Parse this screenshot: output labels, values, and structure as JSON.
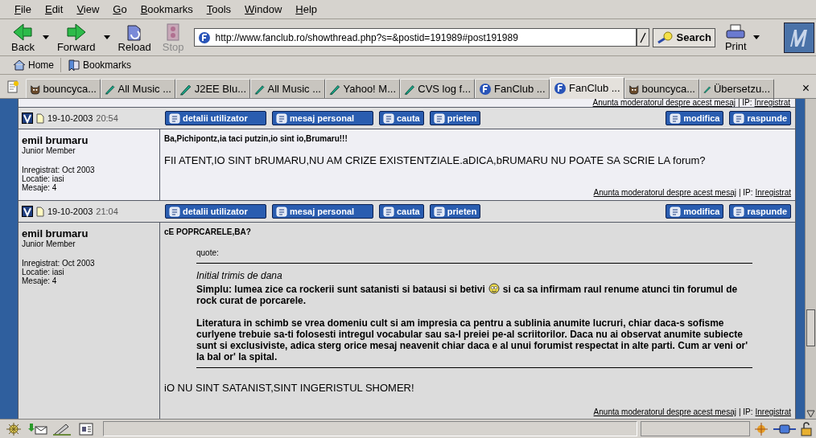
{
  "menu": [
    {
      "label": "File"
    },
    {
      "label": "Edit"
    },
    {
      "label": "View"
    },
    {
      "label": "Go"
    },
    {
      "label": "Bookmarks"
    },
    {
      "label": "Tools"
    },
    {
      "label": "Window"
    },
    {
      "label": "Help"
    }
  ],
  "toolbar": {
    "nav": [
      {
        "kind": "back",
        "label": "Back",
        "disabled": false,
        "dropdown": true
      },
      {
        "kind": "forward",
        "label": "Forward",
        "disabled": false,
        "dropdown": true
      },
      {
        "kind": "reload",
        "label": "Reload",
        "disabled": false,
        "dropdown": false
      },
      {
        "kind": "stop",
        "label": "Stop",
        "disabled": true,
        "dropdown": false
      }
    ],
    "url": "http://www.fanclub.ro/showthread.php?s=&postid=191989#post191989",
    "search": "Search",
    "print": "Print"
  },
  "personal_bar": [
    {
      "kind": "home",
      "label": "Home"
    },
    {
      "kind": "bookmarks",
      "label": "Bookmarks"
    }
  ],
  "tabs": [
    {
      "kind": "cat",
      "label": "bouncyca...",
      "selected": false
    },
    {
      "kind": "pen",
      "label": "All Music ...",
      "selected": false
    },
    {
      "kind": "pen",
      "label": "J2EE Blu...",
      "selected": false
    },
    {
      "kind": "pen",
      "label": "All Music ...",
      "selected": false
    },
    {
      "kind": "pen",
      "label": "Yahoo! M...",
      "selected": false
    },
    {
      "kind": "pen",
      "label": "CVS log f...",
      "selected": false
    },
    {
      "kind": "globe",
      "label": "FanClub ...",
      "selected": false
    },
    {
      "kind": "globe",
      "label": "FanClub ...",
      "selected": true
    },
    {
      "kind": "cat",
      "label": "bouncyca...",
      "selected": false
    },
    {
      "kind": "pen",
      "label": "Übersetzu...",
      "selected": false
    }
  ],
  "tab_close": "×",
  "progress": {
    "level": 0
  },
  "prev_footer": {
    "report": "Anunta moderatorul despre acest mesaj",
    "ip_label": "| IP:",
    "ip": "Inregistrat"
  },
  "posts": [
    {
      "date": "19-10-2003",
      "time": "20:54",
      "buttons": [
        "detalii utilizator",
        "mesaj personal",
        "cauta",
        "prieten"
      ],
      "actions": [
        "modifica",
        "raspunde"
      ],
      "author": "emil brumaru",
      "rank": "Junior Member",
      "info": [
        "Inregistrat: Oct 2003",
        "Locatie: iasi",
        "Mesaje: 4"
      ],
      "title": "Ba,Pichipontz,ia taci putzin,io sint io,Brumaru!!!",
      "body": [
        {
          "kind": "text",
          "text": "FII ATENT,IO SINT bRUMARU,NU AM CRIZE EXISTENTZIALE.aDICA,bRUMARU NU POATE SA SCRIE LA forum?"
        }
      ],
      "footer": {
        "report": "Anunta moderatorul despre acest mesaj",
        "ip_label": "| IP:",
        "ip": "Inregistrat"
      }
    },
    {
      "date": "19-10-2003",
      "time": "21:04",
      "buttons": [
        "detalii utilizator",
        "mesaj personal",
        "cauta",
        "prieten"
      ],
      "actions": [
        "modifica",
        "raspunde"
      ],
      "author": "emil brumaru",
      "rank": "Junior Member",
      "info": [
        "Inregistrat: Oct 2003",
        "Locatie: iasi",
        "Mesaje: 4"
      ],
      "title": "cE POPRCARELE,BA?",
      "body": [
        {
          "kind": "quote",
          "label": "quote:",
          "by": "Initial trimis de dana",
          "paragraphs": [
            {
              "before": "Simplu: lumea zice ca rockerii sunt satanisti si batausi si betivi",
              "smiley": true,
              "after": "si ca sa infirmam raul renume atunci tin forumul de rock curat de porcarele."
            },
            {
              "before": "Literatura in schimb se vrea domeniu cult si am impresia ca pentru a sublinia anumite lucruri, chiar daca-s sofisme curlyene trebuie sa-ti folosesti intregul vocabular sau sa-l preiei pe-al scriitorilor. Daca nu ai observat anumite subiecte sunt si exclusiviste, adica sterg orice mesaj neavenit chiar daca e al unui forumist respectat in alte parti. Cum ar veni or' la bal or' la spital.",
              "smiley": false
            }
          ]
        },
        {
          "kind": "text",
          "text": "iO NU SINT SATANIST,SINT INGERISTUL SHOMER!"
        }
      ],
      "footer": {
        "report": "Anunta moderatorul despre acest mesaj",
        "ip_label": "| IP:",
        "ip": "Inregistrat"
      }
    }
  ]
}
